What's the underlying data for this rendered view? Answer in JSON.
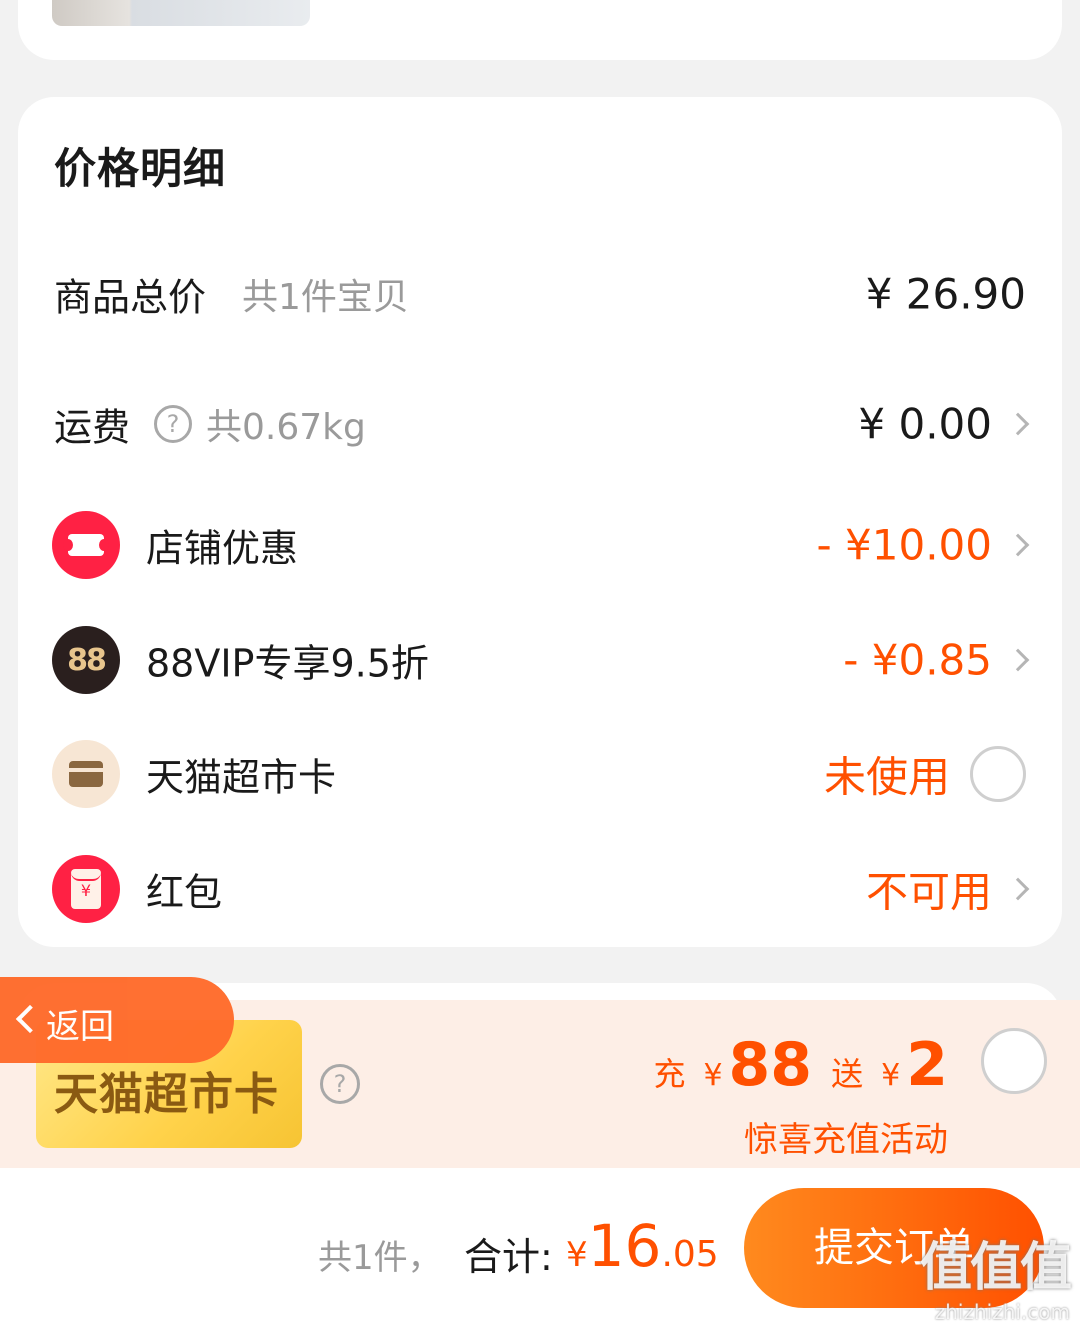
{
  "price_detail": {
    "title": "价格明细",
    "rows": [
      {
        "label": "商品总价",
        "sub": "共1件宝贝",
        "value": "¥ 26.90"
      },
      {
        "label": "运费",
        "sub": "共0.67kg",
        "value": "¥ 0.00"
      },
      {
        "label": "店铺优惠",
        "value": "- ¥10.00",
        "icon": "ticket-icon"
      },
      {
        "label": "88VIP专享9.5折",
        "value": "- ¥0.85",
        "icon": "88vip-icon",
        "icon_text": "88"
      },
      {
        "label": "天猫超市卡",
        "value": "未使用",
        "icon": "card-icon"
      },
      {
        "label": "红包",
        "value": "不可用",
        "icon": "red-envelope-icon",
        "icon_text": "¥"
      }
    ]
  },
  "promo": {
    "card_label": "天猫超市卡",
    "help": "?",
    "recharge_prefix": "充",
    "yen": "¥",
    "recharge_amount": "88",
    "gift_prefix": "送",
    "gift_amount": "2",
    "subtitle": "惊喜充值活动"
  },
  "back": {
    "label": "返回"
  },
  "footer": {
    "count": "共1件，",
    "total_label": "合计:",
    "yen": "¥",
    "total_int": "16",
    "total_dec": ".05",
    "submit_label": "提交订单"
  },
  "watermark": {
    "logo": "值值值",
    "site": "zhizhizhi.com"
  },
  "colors": {
    "accent": "#ff5000",
    "coupon_red": "#ff2144",
    "background": "#f2f2f2"
  }
}
